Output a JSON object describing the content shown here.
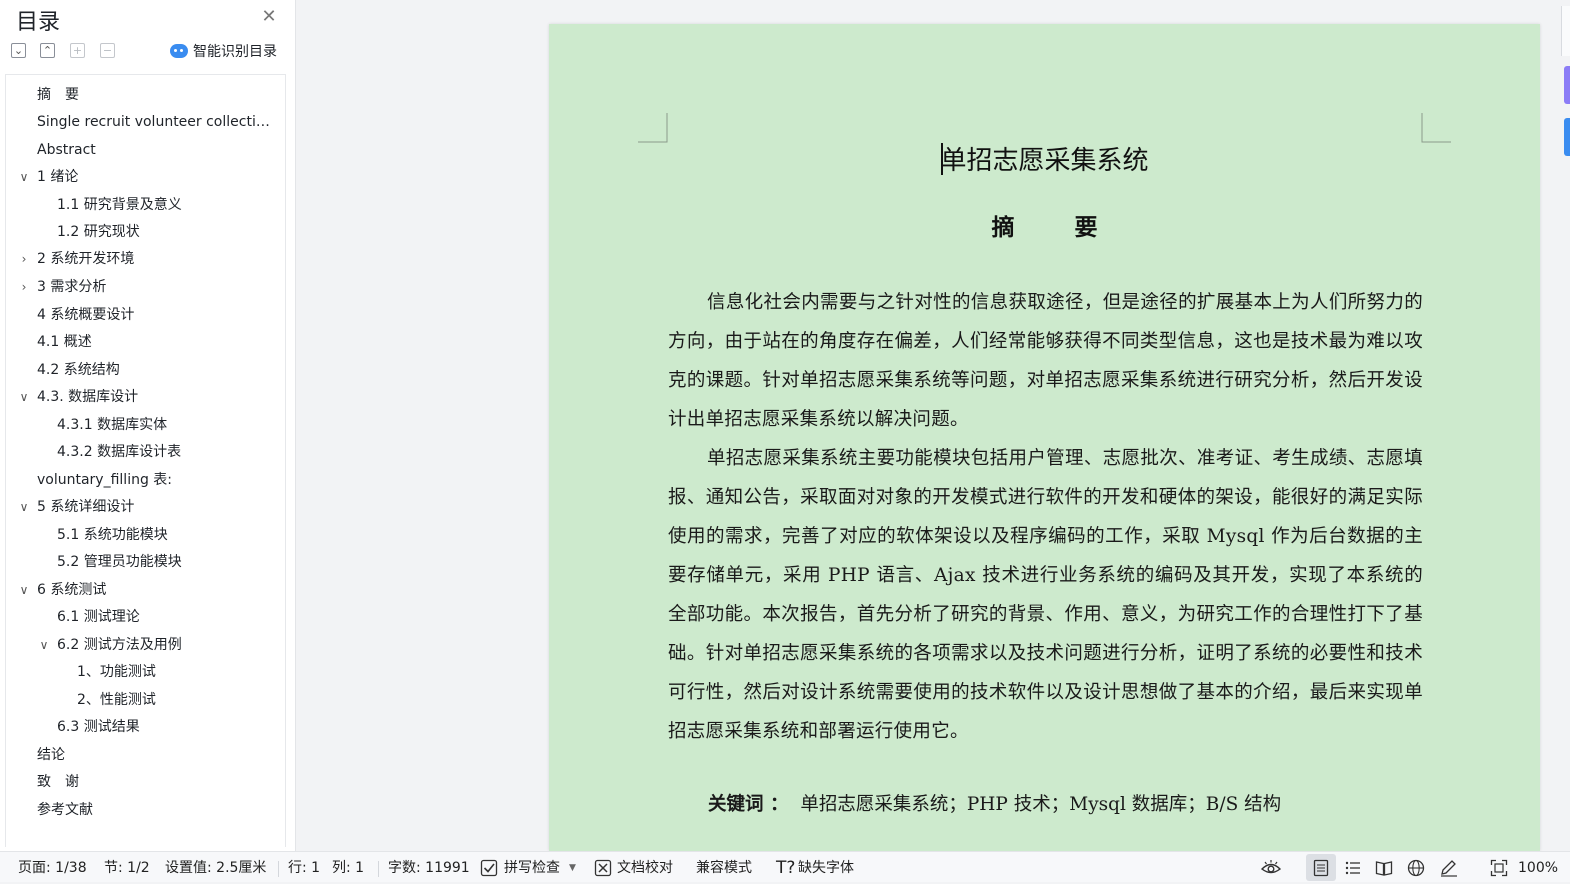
{
  "toc": {
    "title": "目录",
    "smart_toc_label": "智能识别目录",
    "items": [
      {
        "label": "摘　要"
      },
      {
        "label": "Single recruit volunteer collection system"
      },
      {
        "label": "Abstract"
      },
      {
        "label": "1  绪论"
      },
      {
        "label": "1.1 研究背景及意义"
      },
      {
        "label": "1.2 研究现状"
      },
      {
        "label": "2  系统开发环境"
      },
      {
        "label": "3  需求分析"
      },
      {
        "label": "4 系统概要设计"
      },
      {
        "label": "4.1  概述"
      },
      {
        "label": "4.2  系统结构"
      },
      {
        "label": "4.3.  数据库设计"
      },
      {
        "label": "4.3.1  数据库实体"
      },
      {
        "label": "4.3.2  数据库设计表"
      },
      {
        "label": "voluntary_filling 表:"
      },
      {
        "label": "5  系统详细设计"
      },
      {
        "label": "5.1  系统功能模块"
      },
      {
        "label": "5.2 管理员功能模块"
      },
      {
        "label": "6  系统测试"
      },
      {
        "label": "6.1  测试理论"
      },
      {
        "label": "6.2  测试方法及用例"
      },
      {
        "label": "1、功能测试"
      },
      {
        "label": "2、性能测试"
      },
      {
        "label": "6.3 测试结果"
      },
      {
        "label": "结论"
      },
      {
        "label": "致　谢"
      },
      {
        "label": "参考文献"
      }
    ]
  },
  "document": {
    "title": "单招志愿采集系统",
    "abstract_heading": "摘  要",
    "paragraph1": "信息化社会内需要与之针对性的信息获取途径，但是途径的扩展基本上为人们所努力的方向，由于站在的角度存在偏差，人们经常能够获得不同类型信息，这也是技术最为难以攻克的课题。针对单招志愿采集系统等问题，对单招志愿采集系统进行研究分析，然后开发设计出单招志愿采集系统以解决问题。",
    "paragraph2": "单招志愿采集系统主要功能模块包括用户管理、志愿批次、准考证、考生成绩、志愿填报、通知公告，采取面对对象的开发模式进行软件的开发和硬体的架设，能很好的满足实际使用的需求，完善了对应的软体架设以及程序编码的工作，采取 Mysql 作为后台数据的主要存储单元，采用 PHP 语言、Ajax 技术进行业务系统的编码及其开发，实现了本系统的全部功能。本次报告，首先分析了研究的背景、作用、意义，为研究工作的合理性打下了基础。针对单招志愿采集系统的各项需求以及技术问题进行分析，证明了系统的必要性和技术可行性，然后对设计系统需要使用的技术软件以及设计思想做了基本的介绍，最后来实现单招志愿采集系统和部署运行使用它。",
    "keywords_label": "关键词 ：",
    "keywords_value": "单招志愿采集系统；PHP 技术；Mysql 数据库；B/S 结构"
  },
  "status_bar": {
    "page": "页面: 1/38",
    "section": "节: 1/2",
    "setting": "设置值: 2.5厘米",
    "row": "行: 1",
    "col": "列: 1",
    "word_count": "字数: 11991",
    "spell_check": "拼写检查",
    "doc_proof": "文档校对",
    "compat_mode": "兼容模式",
    "missing_font": "缺失字体",
    "zoom": "100%"
  },
  "colors": {
    "page_background": "#cdeacd",
    "accent_blue": "#3a8cf0"
  }
}
